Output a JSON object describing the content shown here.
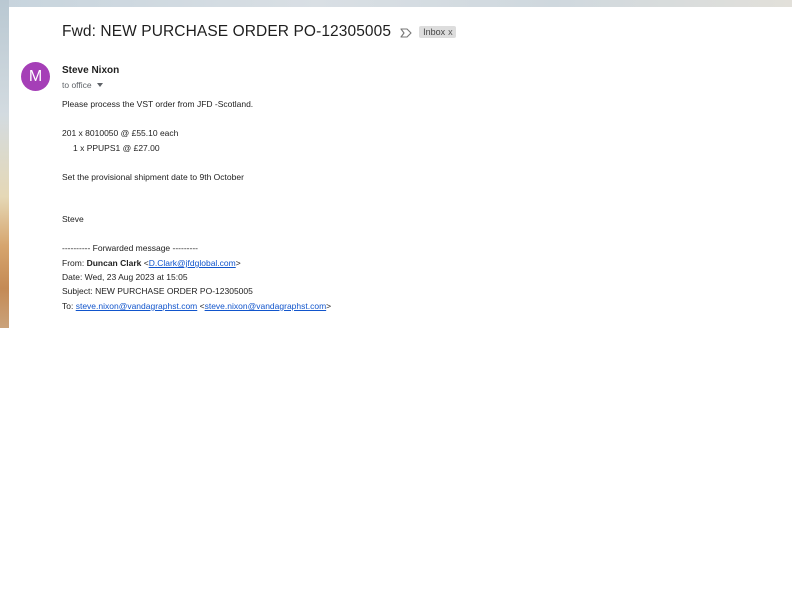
{
  "email": {
    "subject": "Fwd: NEW PURCHASE ORDER PO-12305005",
    "label": "Inbox",
    "label_remove": "x",
    "avatar_letter": "M",
    "avatar_color": "#a53fb7",
    "sender_name": "Steve Nixon",
    "recipient": "to office",
    "body": {
      "line1": "Please process the VST order from JFD -Scotland.",
      "line2": "201 x 8010050 @ £55.10 each",
      "line3": "1 x PPUPS1 @ £27.00",
      "line4": "Set the provisional shipment date to 9th October",
      "signature": "Steve"
    },
    "forwarded": {
      "header": "---------- Forwarded message ---------",
      "from_label": "From: ",
      "from_name": "Duncan Clark",
      "from_email": "D.Clark@jfdglobal.com",
      "date_line": "Date: Wed, 23 Aug 2023 at 15:05",
      "subject_line": "Subject: NEW PURCHASE ORDER PO-12305005",
      "to_label": "To: ",
      "to_email_link": "steve.nixon@vandagraphst.com",
      "to_email_bracket": "steve.nixon@vandagraphst.com"
    }
  }
}
